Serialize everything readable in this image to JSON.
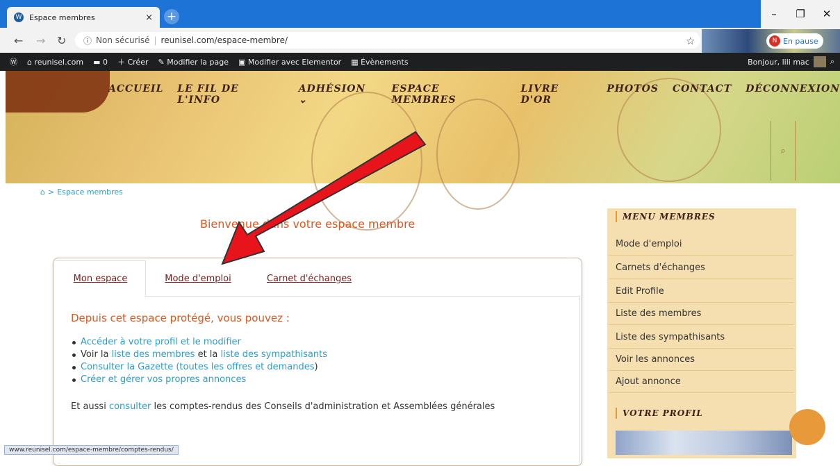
{
  "browser": {
    "tab_title": "Espace membres",
    "tab_close": "×",
    "new_tab": "+",
    "win_min": "–",
    "win_max": "❐",
    "win_close": "✕",
    "security": "Non sécurisé",
    "url": "reunisel.com/espace-membre/",
    "pause_initial": "N",
    "pause_label": "En pause"
  },
  "wpbar": {
    "site": "reunisel.com",
    "comments": "0",
    "create": "Créer",
    "edit_page": "Modifier la page",
    "elementor": "Modifier avec Elementor",
    "events": "Évènements",
    "greeting": "Bonjour, lili mac"
  },
  "nav": {
    "items": [
      "ACCUEIL",
      "LE FIL DE L'INFO",
      "ADHÉSION ⌄",
      "ESPACE MEMBRES",
      "LIVRE D'OR",
      "PHOTOS",
      "CONTACT",
      "DÉCONNEXION"
    ]
  },
  "breadcrumb": {
    "home": "⌂",
    "sep": ">",
    "current": "Espace membres"
  },
  "welcome": "Bienvenue dans votre espace membre",
  "tabs": {
    "mon_espace": "Mon espace",
    "mode_emploi": "Mode d'emploi",
    "carnet": "Carnet d'échanges"
  },
  "panel": {
    "title": "Depuis cet espace protégé, vous pouvez :",
    "item1": "Accéder à votre profil et le modifier",
    "item2_pre": "Voir la ",
    "item2_link1": "liste des membres",
    "item2_mid": " et la ",
    "item2_link2": "liste des sympathisants",
    "item3_link": "Consulter la Gazette (toutes les offres et demandes",
    "item3_post": ")",
    "item4": "Créer et gérer vos propres annonces",
    "extra_pre": "Et aussi ",
    "extra_link": "consulter",
    "extra_post": " les comptes-rendus des Conseils d'administration et Assemblées générales"
  },
  "sidebar": {
    "head1": "MENU MEMBRES",
    "items": [
      "Mode d'emploi",
      "Carnets d'échanges",
      "Edit Profile",
      "Liste des membres",
      "Liste des sympathisants",
      "Voir les annonces",
      "Ajout annonce"
    ],
    "head2": "VOTRE PROFIL"
  },
  "status": "www.reunisel.com/espace-membre/comptes-rendus/",
  "colors": {
    "accent": "#e2561c",
    "link": "#2a9dcf",
    "arrow": "#e8141c"
  }
}
